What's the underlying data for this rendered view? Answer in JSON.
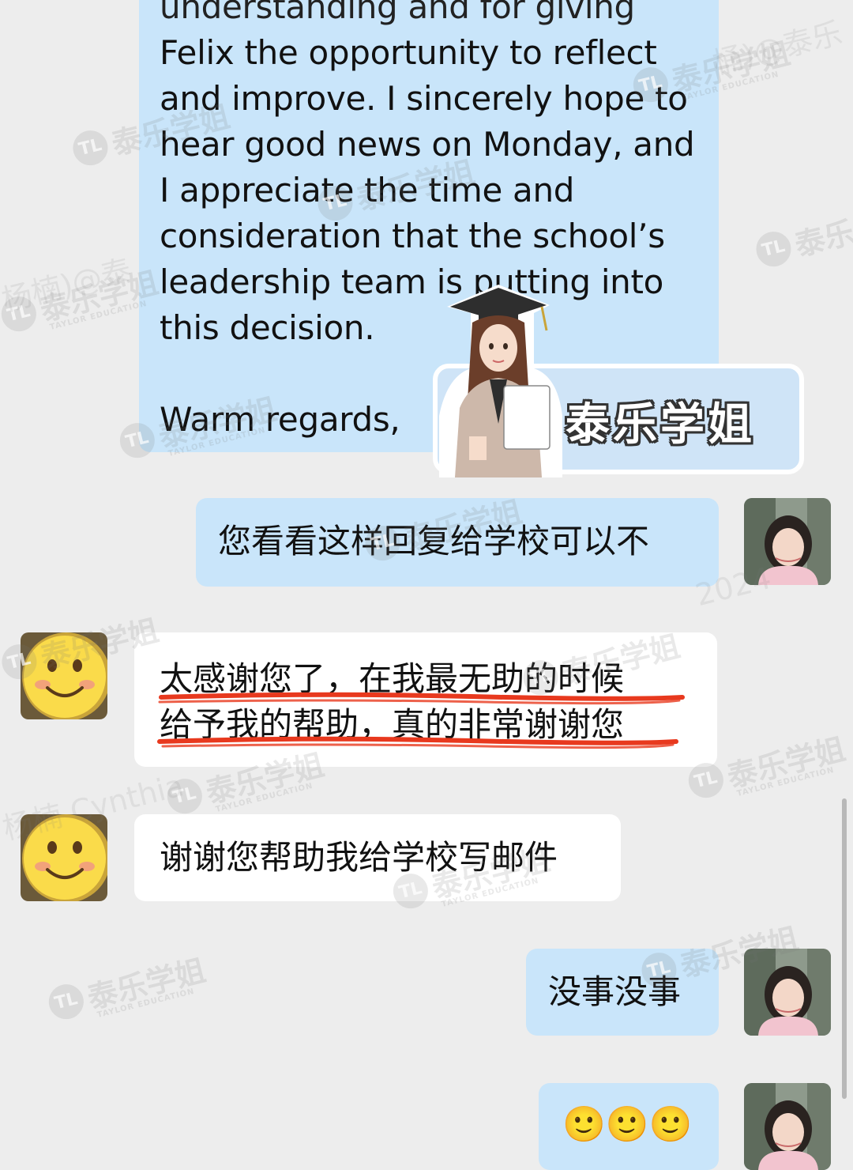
{
  "email": {
    "lines": [
      "understanding and for giving",
      "Felix the opportunity to reflect",
      "and improve. I sincerely hope to",
      "hear good news on Monday, and",
      "I appreciate the time and",
      "consideration that the school’s",
      "leadership team is putting into",
      "this decision."
    ],
    "closing": "Warm regards,"
  },
  "sticker": {
    "label": "泰乐学姐"
  },
  "messages": [
    {
      "side": "right",
      "avatar": "user-photo-avatar",
      "text": "您看看这样回复给学校可以不"
    },
    {
      "side": "left",
      "avatar": "smiley-avatar",
      "lines": [
        "太感谢您了，在我最无助的时候",
        "给予我的帮助，真的非常谢谢您"
      ],
      "highlight_color": "#E8391E"
    },
    {
      "side": "left",
      "avatar": "smiley-avatar",
      "text": "谢谢您帮助我给学校写邮件"
    },
    {
      "side": "right",
      "avatar": "user-photo-avatar",
      "text": "没事没事"
    },
    {
      "side": "right",
      "avatar": "user-photo-avatar",
      "emoji": "🙂🙂🙂"
    }
  ],
  "watermark": {
    "brand": "泰乐学姐",
    "sub": "TAYLOR EDUCATION",
    "name_fragments": [
      "杨楠)@泰",
      "杨楠 Cynthia",
      "2024",
      "桶)@泰乐"
    ]
  },
  "colors": {
    "background": "#EDEDED",
    "sent_bubble": "#C9E5FA",
    "received_bubble": "#FFFFFF",
    "highlight": "#E8391E"
  }
}
